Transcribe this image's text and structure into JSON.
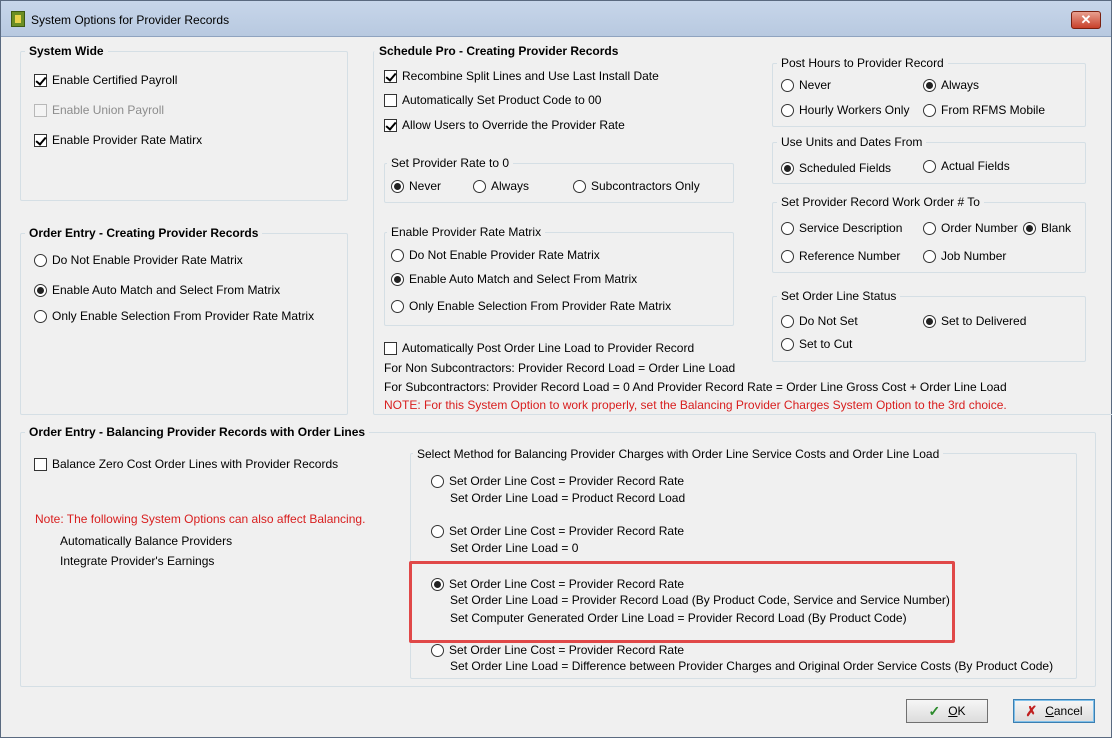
{
  "window": {
    "title": "System Options for Provider Records",
    "close_glyph": "✕"
  },
  "system_wide": {
    "title": "System Wide",
    "items": [
      {
        "label": "Enable Certified Payroll",
        "checked": true,
        "disabled": false
      },
      {
        "label": "Enable Union Payroll",
        "checked": false,
        "disabled": true
      },
      {
        "label": "Enable Provider Rate Matirx",
        "checked": true,
        "disabled": false
      }
    ]
  },
  "order_entry_creating": {
    "title": "Order Entry - Creating Provider Records",
    "options": [
      {
        "label": "Do Not Enable Provider Rate Matrix",
        "selected": false
      },
      {
        "label": "Enable Auto Match and Select From Matrix",
        "selected": true
      },
      {
        "label": "Only Enable Selection From Provider Rate Matrix",
        "selected": false
      }
    ]
  },
  "schedule_pro": {
    "title": "Schedule Pro - Creating Provider Records",
    "checks": [
      {
        "label": "Recombine Split Lines and Use Last Install Date",
        "checked": true
      },
      {
        "label": "Automatically Set Product Code to 00",
        "checked": false
      },
      {
        "label": "Allow Users to Override the Provider Rate",
        "checked": true
      }
    ],
    "rate_zero": {
      "title": "Set Provider Rate to 0",
      "options": [
        {
          "label": "Never",
          "selected": true
        },
        {
          "label": "Always",
          "selected": false
        },
        {
          "label": "Subcontractors Only",
          "selected": false
        }
      ]
    },
    "rate_matrix": {
      "title": "Enable Provider Rate Matrix",
      "options": [
        {
          "label": "Do Not Enable Provider Rate Matrix",
          "selected": false
        },
        {
          "label": "Enable Auto Match and Select From Matrix",
          "selected": true
        },
        {
          "label": "Only Enable Selection From Provider Rate Matrix",
          "selected": false
        }
      ]
    },
    "auto_post": {
      "label": "Automatically Post Order Line Load to Provider Record",
      "checked": false
    },
    "note_lines": [
      "For Non Subcontractors:  Provider Record Load = Order Line Load",
      "For Subcontractors:  Provider Record Load = 0  And  Provider Record Rate = Order Line Gross Cost + Order Line Load"
    ],
    "note_red": "NOTE:  For this System Option to work properly, set the Balancing Provider Charges System Option to the 3rd choice."
  },
  "post_hours": {
    "title": "Post Hours to Provider Record",
    "options": [
      {
        "label": "Never",
        "selected": false
      },
      {
        "label": "Always",
        "selected": true
      },
      {
        "label": "Hourly Workers Only",
        "selected": false
      },
      {
        "label": "From RFMS Mobile",
        "selected": false
      }
    ]
  },
  "units_dates": {
    "title": "Use Units and Dates From",
    "options": [
      {
        "label": "Scheduled Fields",
        "selected": true
      },
      {
        "label": "Actual Fields",
        "selected": false
      }
    ]
  },
  "work_order": {
    "title": "Set Provider Record Work Order # To",
    "options": [
      {
        "label": "Service Description",
        "selected": false
      },
      {
        "label": "Order Number",
        "selected": false
      },
      {
        "label": "Blank",
        "selected": true
      },
      {
        "label": "Reference Number",
        "selected": false
      },
      {
        "label": "Job Number",
        "selected": false
      }
    ]
  },
  "line_status": {
    "title": "Set Order Line Status",
    "options": [
      {
        "label": "Do Not Set",
        "selected": false
      },
      {
        "label": "Set to Delivered",
        "selected": true
      },
      {
        "label": "Set to Cut",
        "selected": false
      }
    ]
  },
  "balancing": {
    "title": "Order Entry - Balancing Provider Records with Order Lines",
    "zero_cost": {
      "label": "Balance Zero Cost Order Lines with Provider Records",
      "checked": false
    },
    "note_red": "Note:  The following System Options can also affect Balancing.",
    "affect_items": [
      "Automatically Balance Providers",
      "Integrate Provider's Earnings"
    ],
    "method": {
      "title": "Select Method for Balancing Provider Charges with Order Line Service Costs and Order Line Load",
      "options": [
        {
          "selected": false,
          "lines": [
            "Set Order Line Cost = Provider Record Rate",
            "Set Order Line Load = Product Record Load"
          ]
        },
        {
          "selected": false,
          "lines": [
            "Set Order Line Cost = Provider Record Rate",
            "Set Order Line Load = 0"
          ]
        },
        {
          "selected": true,
          "lines": [
            "Set Order Line Cost = Provider Record Rate",
            "Set Order Line Load = Provider Record Load (By Product Code, Service and Service Number)",
            "Set Computer Generated Order Line Load = Provider Record Load (By Product Code)"
          ]
        },
        {
          "selected": false,
          "lines": [
            "Set Order Line Cost = Provider Record Rate",
            "Set Order Line Load = Difference between Provider Charges and Original Order Service Costs (By Product Code)"
          ]
        }
      ]
    }
  },
  "buttons": {
    "ok": {
      "key": "O",
      "rest": "K",
      "icon": "checkmark-icon"
    },
    "cancel": {
      "key": "C",
      "rest": "ancel",
      "icon": "x-icon"
    }
  },
  "colors": {
    "note_red": "#d81e1e",
    "highlight": "#e04848",
    "disabled": "#8c8c8c"
  }
}
